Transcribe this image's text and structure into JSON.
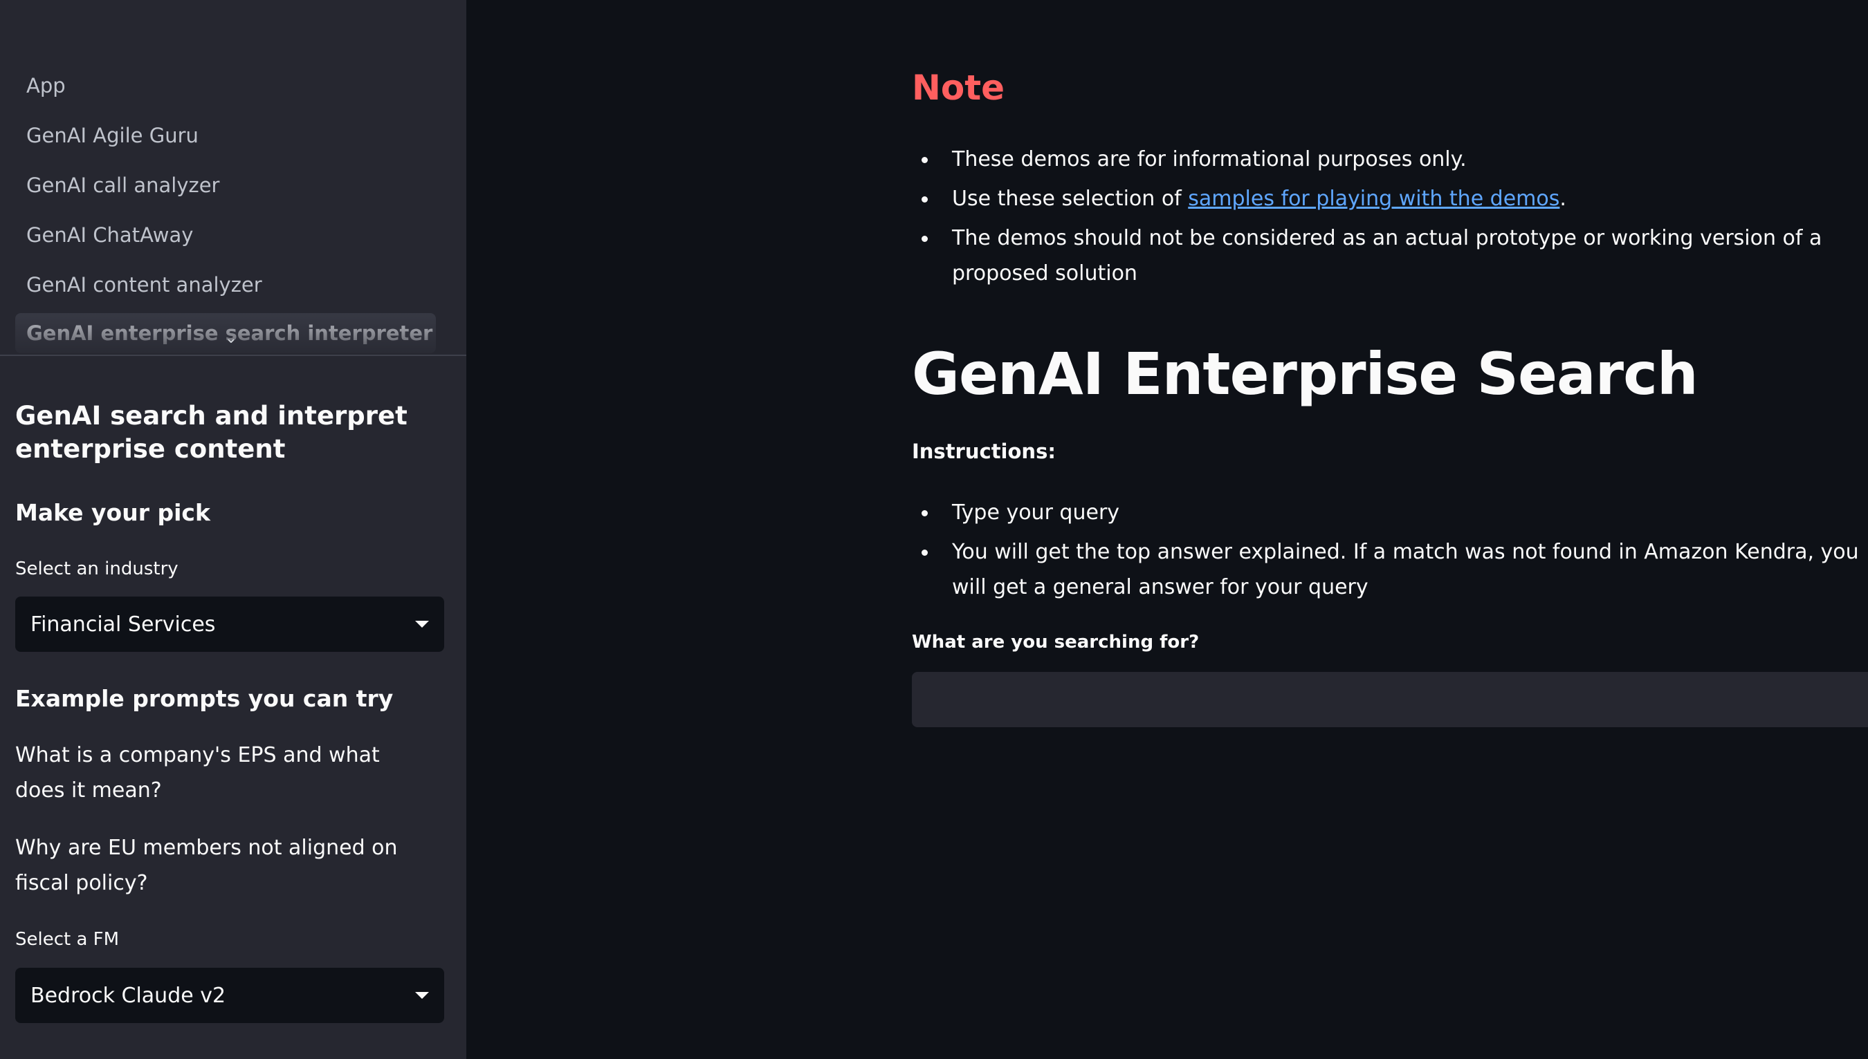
{
  "sidebar": {
    "nav_items": [
      {
        "label": "App"
      },
      {
        "label": "GenAI Agile Guru"
      },
      {
        "label": "GenAI call analyzer"
      },
      {
        "label": "GenAI ChatAway"
      },
      {
        "label": "GenAI content analyzer"
      },
      {
        "label": "GenAI enterprise search interpreter",
        "active": true
      }
    ],
    "title": "GenAI search and interpret enterprise content",
    "pick_heading": "Make your pick",
    "industry_label": "Select an industry",
    "industry_value": "Financial Services",
    "examples_heading": "Example prompts you can try",
    "examples": [
      "What is a company's EPS and what does it mean?",
      "Why are EU members not aligned on fiscal policy?"
    ],
    "fm_label": "Select a FM",
    "fm_value": "Bedrock Claude v2"
  },
  "main": {
    "note_title": "Note",
    "note_items": {
      "item1": "These demos are for informational purposes only.",
      "item2_prefix": "Use these selection of ",
      "item2_link": "samples for playing with the demos",
      "item2_suffix": ".",
      "item3": "The demos should not be considered as an actual prototype or working version of a proposed solution"
    },
    "title": "GenAI Enterprise Search",
    "instructions_label": "Instructions:",
    "instructions": [
      "Type your query",
      "You will get the top answer explained. If a match was not found in Amazon Kendra, you will get a general answer for your query"
    ],
    "search_label": "What are you searching for?",
    "search_value": ""
  },
  "colors": {
    "background": "#0e1117",
    "sidebar": "#262730",
    "note_title": "#ff5f5f",
    "link": "#5fa7ff"
  },
  "icons": {
    "nav_expand": "chevron-down-icon",
    "select_caret": "caret-down-icon"
  }
}
